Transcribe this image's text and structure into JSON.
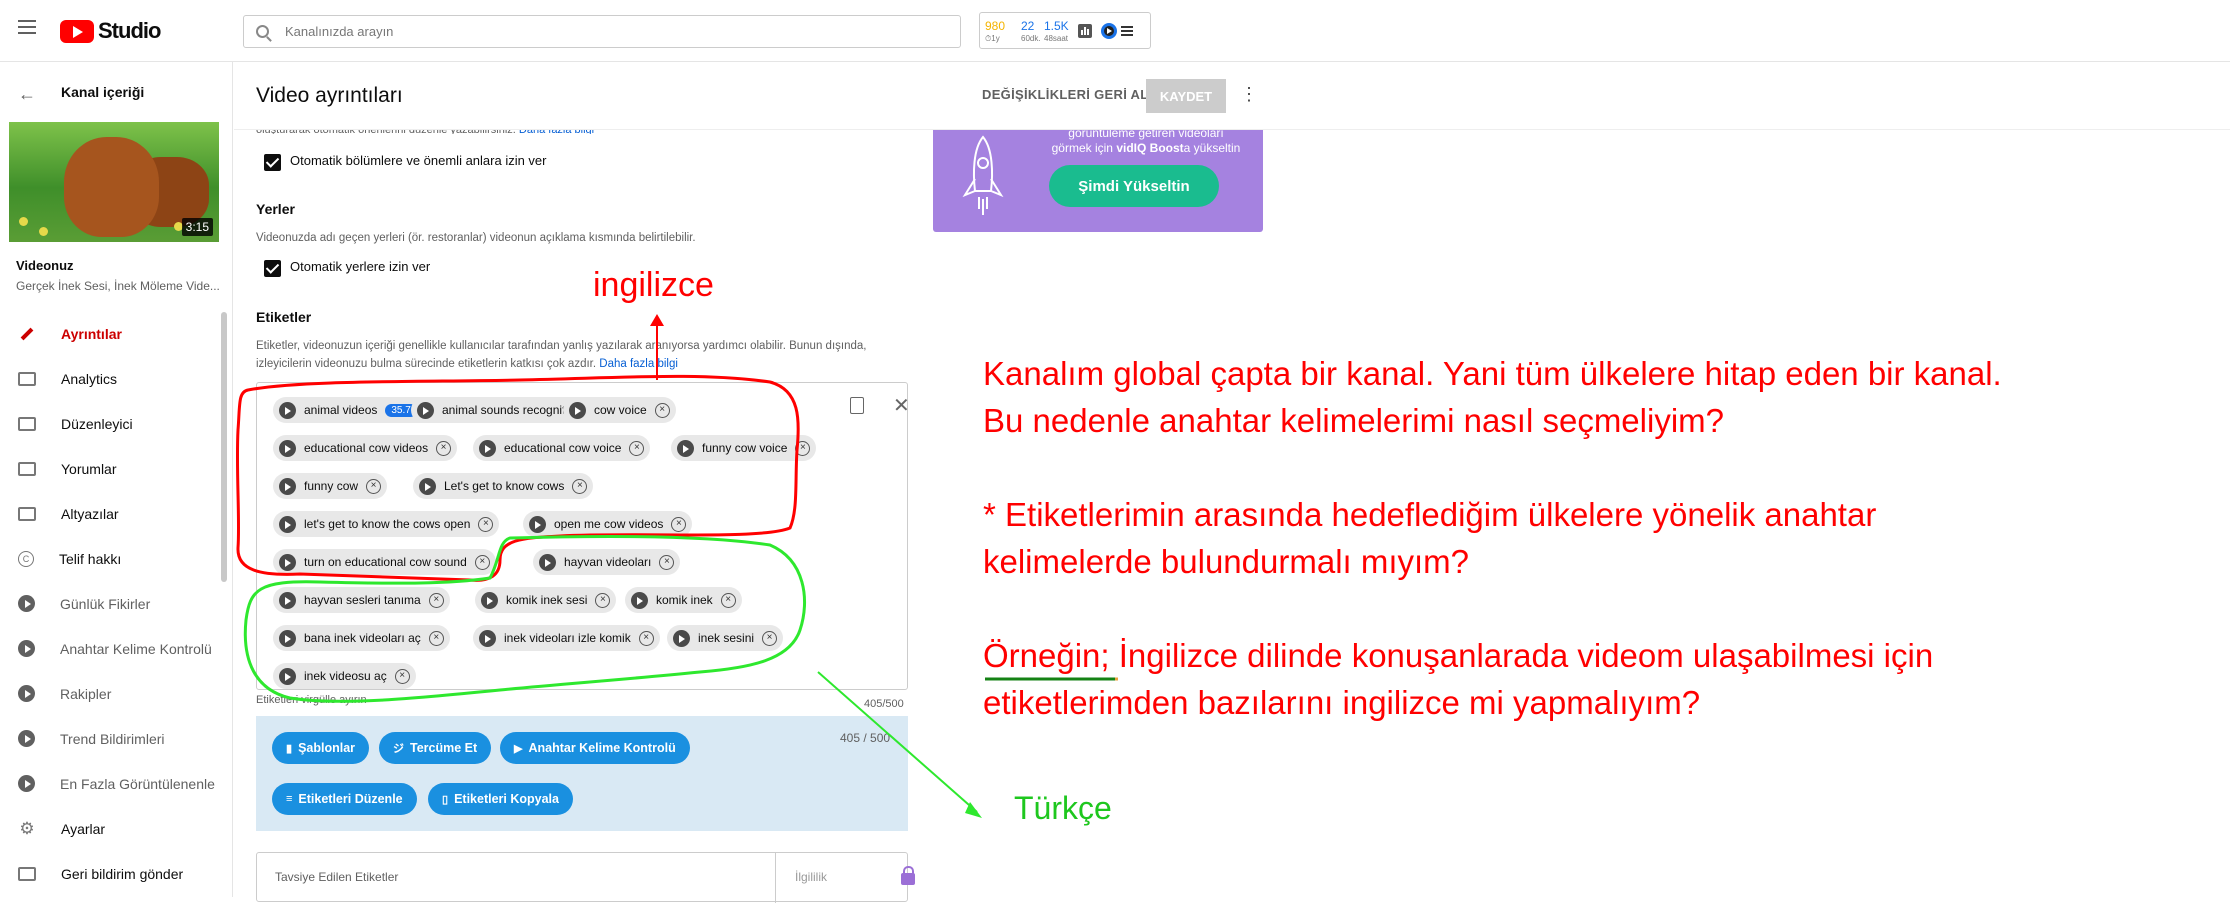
{
  "topbar": {
    "brand": "Studio",
    "search_placeholder": "Kanalınızda arayın",
    "stats": [
      {
        "value": "980",
        "sub": "⏱1y",
        "color": "#f4b400"
      },
      {
        "value": "22",
        "sub": "60dk.",
        "color": "#1a73e8"
      },
      {
        "value": "1.5K",
        "sub": "48saat",
        "color": "#1a73e8"
      }
    ]
  },
  "sidebar": {
    "back_label": "Kanal içeriği",
    "thumbnail_duration": "3:15",
    "video_heading": "Videonuz",
    "video_title": "Gerçek İnek Sesi, İnek Möleme Vide...",
    "items": [
      {
        "label": "Ayrıntılar",
        "icon": "pencil-icon"
      },
      {
        "label": "Analytics",
        "icon": "analytics-icon"
      },
      {
        "label": "Düzenleyici",
        "icon": "editor-icon"
      },
      {
        "label": "Yorumlar",
        "icon": "comments-icon"
      },
      {
        "label": "Altyazılar",
        "icon": "subtitles-icon"
      },
      {
        "label": "Telif hakkı",
        "icon": "copyright-icon"
      },
      {
        "label": "Günlük Fikirler",
        "icon": "vidiq-icon"
      },
      {
        "label": "Anahtar Kelime Kontrolü",
        "icon": "vidiq-icon"
      },
      {
        "label": "Rakipler",
        "icon": "vidiq-icon"
      },
      {
        "label": "Trend Bildirimleri",
        "icon": "vidiq-icon"
      },
      {
        "label": "En Fazla Görüntülenenle",
        "icon": "vidiq-icon"
      },
      {
        "label": "Ayarlar",
        "icon": "gear-icon"
      },
      {
        "label": "Geri bildirim gönder",
        "icon": "feedback-icon"
      }
    ]
  },
  "header": {
    "title": "Video ayrıntıları",
    "undo_label": "DEĞİŞİKLİKLERİ GERİ AL",
    "save_label": "KAYDET"
  },
  "form": {
    "cut_text": "oluşturarak otomatik önerilerini düzenle yazabilirsiniz.",
    "cut_link": "Daha fazla bilgi",
    "chapters_label": "Otomatik bölümlere ve önemli anlara izin ver",
    "places_heading": "Yerler",
    "places_desc": "Videonuzda adı geçen yerleri (ör. restoranlar) videonun açıklama kısmında belirtilebilir.",
    "places_label": "Otomatik yerlere izin ver",
    "tags_heading": "Etiketler",
    "tags_desc1": "Etiketler, videonuzun içeriği genellikle kullanıcılar tarafından yanlış yazılarak aranıyorsa yardımcı olabilir. Bunun dışında,",
    "tags_desc2": "izleyicilerin videonuzu bulma sürecinde etiketlerin katkısı çok azdır.",
    "tags_link": "Daha fazla bilgi",
    "tags": [
      "animal videos",
      "animal sounds recognition",
      "cow voice",
      "educational cow videos",
      "educational cow voice",
      "funny cow voice",
      "funny cow",
      "Let's get to know cows",
      "let's get to know the cows open",
      "open me cow videos",
      "turn on educational cow sound",
      "hayvan videoları",
      "hayvan sesleri tanıma",
      "komik inek sesi",
      "komik inek",
      "bana inek videoları aç",
      "inek videoları izle komik",
      "inek sesini",
      "inek videosu aç"
    ],
    "first_tag_score": "35.7",
    "tags_hint": "Etiketleri virgülle ayırın",
    "tags_count": "405/500",
    "tools_count": "405 / 500",
    "tool_buttons": [
      "Şablonlar",
      "Tercüme Et",
      "Anahtar Kelime Kontrolü",
      "Etiketleri Düzenle",
      "Etiketleri Kopyala"
    ],
    "rec_placeholder": "Tavsiye Edilen Etiketler",
    "rec_relevance": "İlgililik"
  },
  "promo": {
    "line1": "görüntüleme getiren videoları",
    "line2_prefix": "görmek için ",
    "line2_brand": "vidIQ Boost",
    "line2_suffix": "a yükseltin",
    "cta": "Şimdi Yükseltin"
  },
  "annotations": {
    "english_label": "ingilizce",
    "turkish_label": "Türkçe",
    "question_lines": [
      "Kanalım global çapta bir kanal. Yani tüm ülkelere hitap eden bir kanal.",
      "Bu nedenle anahtar kelimelerimi nasıl seçmeliyim?",
      "",
      "* Etiketlerimin arasında hedeflediğim ülkelere yönelik anahtar",
      "kelimelerde bulundurmalı mıyım?",
      "",
      "Örneğin; İngilizce dilinde konuşanlarada videom ulaşabilmesi için",
      "etiketlerimden bazılarını ingilizce mi yapmalıyım?"
    ],
    "colors": {
      "red": "#ff0000",
      "green": "#1ec71e"
    }
  }
}
